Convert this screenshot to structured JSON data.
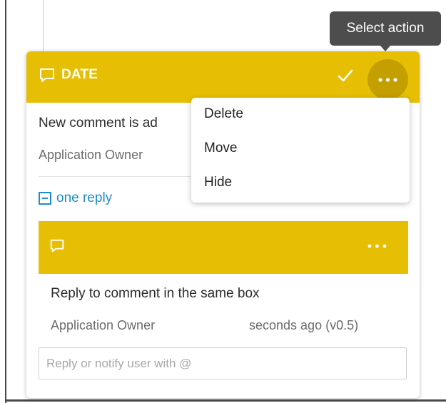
{
  "tooltip": {
    "text": "Select action"
  },
  "comment": {
    "title": "DATE",
    "text": "New comment is ad",
    "author": "Application Owner",
    "reply_toggle": "one reply"
  },
  "menu": {
    "items": [
      {
        "label": "Delete"
      },
      {
        "label": "Move"
      },
      {
        "label": "Hide"
      }
    ]
  },
  "reply": {
    "text": "Reply to comment in the same box",
    "author": "Application Owner",
    "time": "seconds ago (v0.5)"
  },
  "reply_input": {
    "placeholder": "Reply or notify user with @",
    "value": ""
  },
  "colors": {
    "header": "#e6bf04",
    "more_button": "#c49f00",
    "link": "#1f8dc9",
    "tooltip": "#4d4d4d"
  },
  "icons": {
    "header": "comment-icon",
    "resolve": "check-icon",
    "more": "more-dots-icon",
    "collapse": "minus-square-icon",
    "reply": "comment-icon"
  }
}
